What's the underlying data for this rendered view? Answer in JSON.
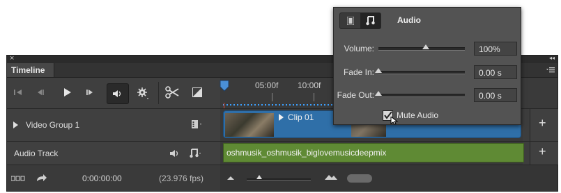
{
  "panel": {
    "tab_title": "Timeline",
    "close_glyph": "×",
    "collapse_glyph": "◂◂"
  },
  "ruler": {
    "labels": [
      "05:00f",
      "10:00f"
    ]
  },
  "tracks": {
    "video_group": {
      "label": "Video Group 1"
    },
    "audio_track": {
      "label": "Audio Track"
    }
  },
  "clips": {
    "video_clip": {
      "label": "Clip 01"
    },
    "audio_clip": {
      "label": "oshmusik_oshmusik_biglovemusicdeepmix"
    }
  },
  "footer": {
    "timecode": "0:00:00:00",
    "fps": "(23.976 fps)"
  },
  "audio_popup": {
    "title": "Audio",
    "volume": {
      "label": "Volume:",
      "value": "100%",
      "level": 0.55
    },
    "fade_in": {
      "label": "Fade In:",
      "value": "0.00 s",
      "level": 0.0
    },
    "fade_out": {
      "label": "Fade Out:",
      "value": "0.00 s",
      "level": 0.0
    },
    "mute": {
      "label": "Mute Audio",
      "checked": true
    }
  },
  "colors": {
    "panel_bg": "#3d3d3d",
    "video_clip": "#2f6fa8",
    "audio_clip": "#5f8a34",
    "playhead": "#4a8fd6"
  },
  "icons": [
    "close-icon",
    "collapse-icon",
    "panel-menu-icon",
    "go-to-start-icon",
    "previous-frame-icon",
    "play-icon",
    "next-frame-icon",
    "audio-icon",
    "settings-icon",
    "split-icon",
    "transition-icon",
    "playhead-icon",
    "expand-arrow-icon",
    "film-icon",
    "speaker-icon",
    "music-note-icon",
    "add-track-icon",
    "render-video-icon",
    "convert-frame-icon",
    "zoom-out-icon",
    "zoom-in-icon"
  ]
}
